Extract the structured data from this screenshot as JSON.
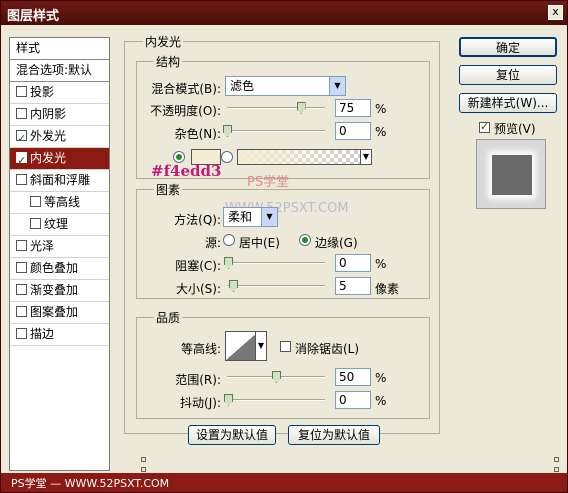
{
  "window": {
    "title": "图层样式",
    "close_glyph": "x"
  },
  "sidebar": {
    "header": "样式",
    "blend_options": "混合选项:默认",
    "items": [
      {
        "label": "投影",
        "checked": false
      },
      {
        "label": "内阴影",
        "checked": false
      },
      {
        "label": "外发光",
        "checked": true
      },
      {
        "label": "内发光",
        "checked": true,
        "selected": true
      },
      {
        "label": "斜面和浮雕",
        "checked": false
      },
      {
        "label": "等高线",
        "checked": false,
        "sub": true
      },
      {
        "label": "纹理",
        "checked": false,
        "sub": true
      },
      {
        "label": "光泽",
        "checked": false
      },
      {
        "label": "颜色叠加",
        "checked": false
      },
      {
        "label": "渐变叠加",
        "checked": false
      },
      {
        "label": "图案叠加",
        "checked": false
      },
      {
        "label": "描边",
        "checked": false
      }
    ]
  },
  "panel": {
    "title": "内发光",
    "structure": {
      "title": "结构",
      "blend_mode_label": "混合模式(B):",
      "blend_mode_value": "滤色",
      "opacity_label": "不透明度(O):",
      "opacity_value": "75",
      "opacity_unit": "%",
      "opacity_level": 0.75,
      "noise_label": "杂色(N):",
      "noise_value": "0",
      "noise_unit": "%",
      "noise_level": 0,
      "color_hex": "#f4edd3",
      "color_annotation": "#f4edd3"
    },
    "elements": {
      "title": "图素",
      "method_label": "方法(Q):",
      "method_value": "柔和",
      "source_label": "源:",
      "source_center": "居中(E)",
      "source_edge": "边缘(G)",
      "choke_label": "阻塞(C):",
      "choke_value": "0",
      "choke_unit": "%",
      "size_label": "大小(S):",
      "size_value": "5",
      "size_unit": "像素"
    },
    "quality": {
      "title": "品质",
      "contour_label": "等高线:",
      "antialias_label": "消除锯齿(L)",
      "range_label": "范围(R):",
      "range_value": "50",
      "range_unit": "%",
      "range_level": 0.5,
      "jitter_label": "抖动(J):",
      "jitter_value": "0",
      "jitter_unit": "%"
    },
    "make_default": "设置为默认值",
    "reset_default": "复位为默认值"
  },
  "buttons": {
    "ok": "确定",
    "reset": "复位",
    "new_style": "新建样式(W)...",
    "preview": "预览(V)"
  },
  "watermarks": {
    "ps": "PS学堂",
    "url": "WWW.52PSXT.COM",
    "footer": "PS学堂 — WWW.52PSXT.COM"
  }
}
